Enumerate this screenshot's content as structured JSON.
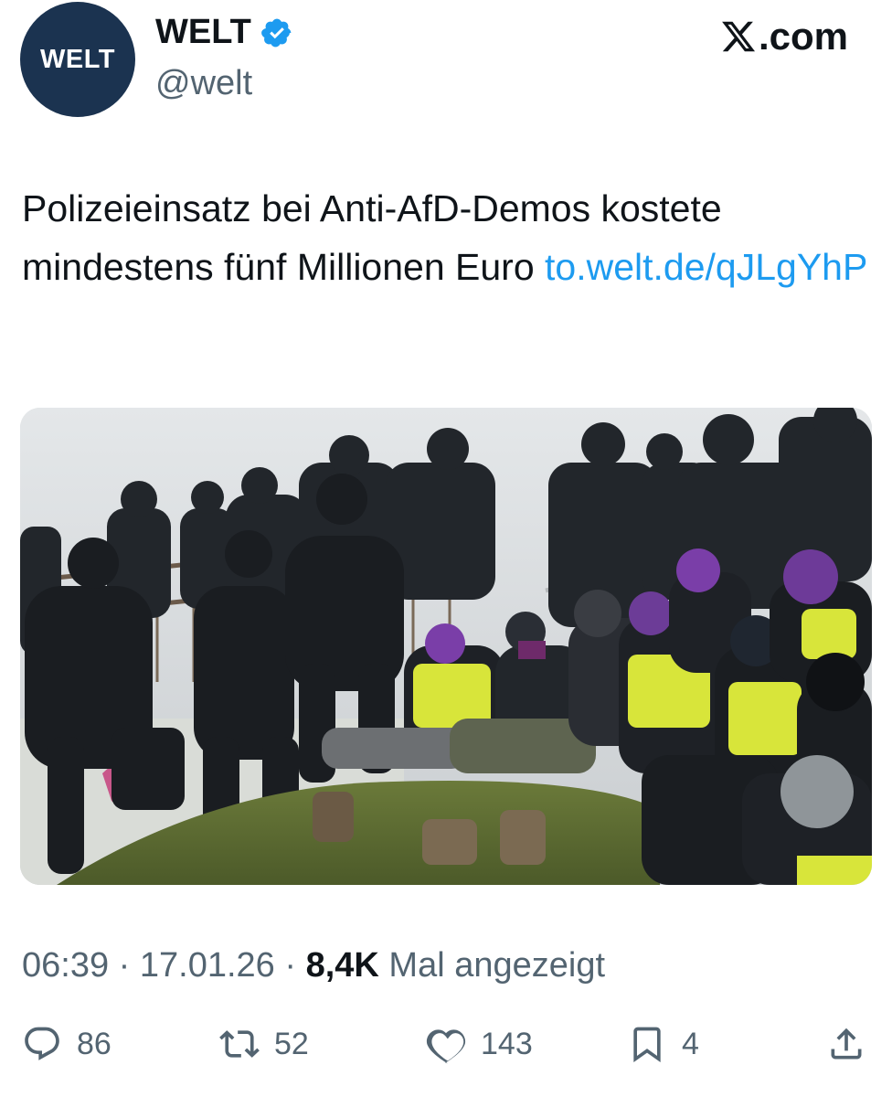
{
  "account": {
    "avatar_text": "WELT",
    "display_name": "WELT",
    "handle": "@welt",
    "verified_icon": "verified-badge-icon",
    "avatar_color": "#1b3350"
  },
  "brand": {
    "x_logo": "x-logo-icon",
    "site": ".com"
  },
  "tweet": {
    "text": "Polizeieinsatz bei Anti-AfD-Demos kostete mindestens fünf Millionen Euro ",
    "link": "to.welt.de/qJLgYhP",
    "link_color": "#1d9bf0"
  },
  "media": {
    "type": "photo",
    "description_icon": "photo-icon"
  },
  "meta": {
    "time": "06:39",
    "sep1": " · ",
    "date": "17.01.26",
    "sep2": " · ",
    "views": "8,4K",
    "views_label": " Mal angezeigt"
  },
  "actions": {
    "reply": {
      "icon": "reply-icon",
      "count": "86"
    },
    "repost": {
      "icon": "repost-icon",
      "count": "52"
    },
    "like": {
      "icon": "heart-icon",
      "count": "143"
    },
    "bookmark": {
      "icon": "bookmark-icon",
      "count": "4"
    },
    "share": {
      "icon": "share-icon"
    }
  }
}
